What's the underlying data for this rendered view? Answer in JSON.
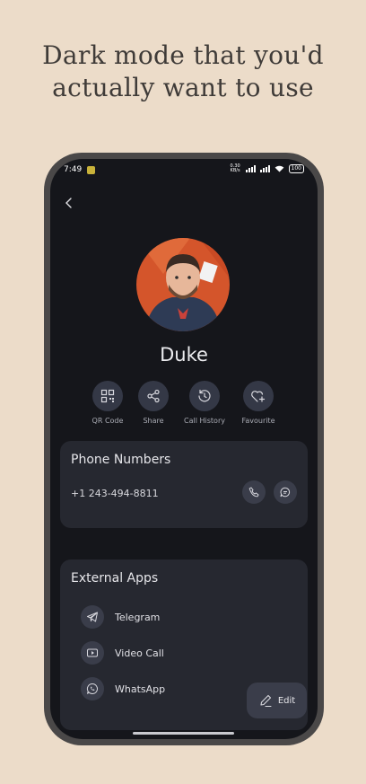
{
  "headline": {
    "line1": "Dark mode that you'd",
    "line2": "actually want to use"
  },
  "status_bar": {
    "time": "7:49",
    "net_speed_value": "0.30",
    "net_speed_unit": "KB/s",
    "battery": "100"
  },
  "contact": {
    "name": "Duke"
  },
  "actions": [
    {
      "label": "QR Code",
      "icon": "qr-code-icon"
    },
    {
      "label": "Share",
      "icon": "share-icon"
    },
    {
      "label": "Call History",
      "icon": "history-icon"
    },
    {
      "label": "Favourite",
      "icon": "heart-plus-icon"
    }
  ],
  "phone_section": {
    "title": "Phone Numbers",
    "number": "+1 243-494-8811"
  },
  "external_apps": {
    "title": "External Apps",
    "items": [
      {
        "label": "Telegram",
        "icon": "telegram-icon"
      },
      {
        "label": "Video Call",
        "icon": "video-call-icon"
      },
      {
        "label": "WhatsApp",
        "icon": "whatsapp-icon"
      }
    ]
  },
  "edit_button": {
    "label": "Edit"
  },
  "colors": {
    "background": "#ecdcc9",
    "screen": "#15161b",
    "card": "#262830",
    "icon_circle": "#343846"
  }
}
